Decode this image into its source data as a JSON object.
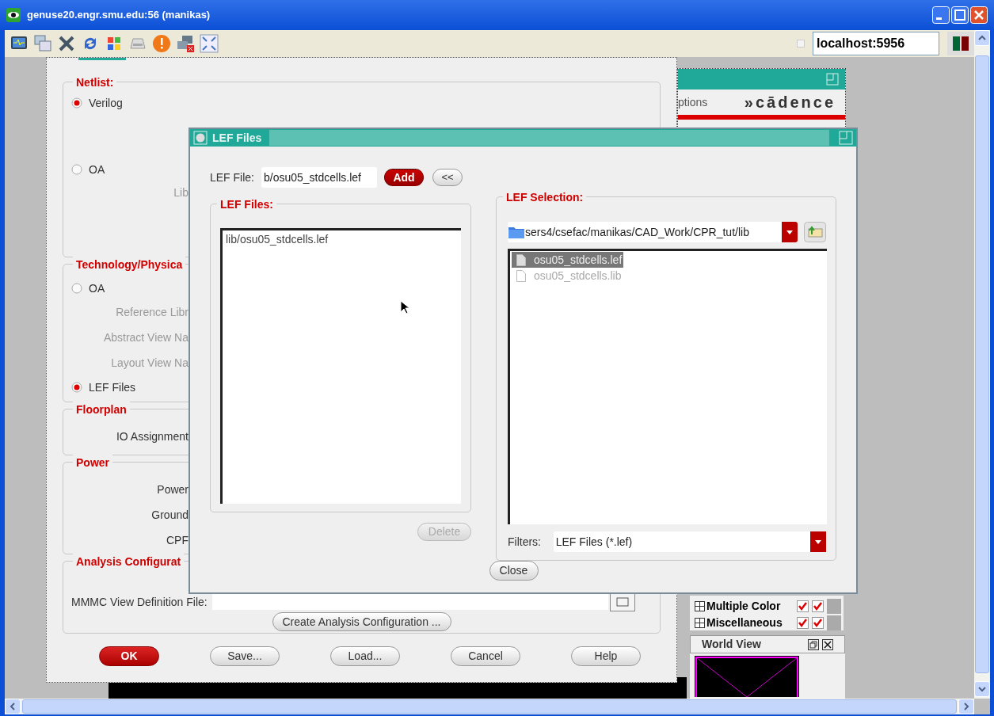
{
  "window": {
    "title": "genuse20.engr.smu.edu:56 (manikas)"
  },
  "toolbar": {
    "host": "localhost:5956"
  },
  "back_window": {
    "options_label": "ptions",
    "logo": "»cādence",
    "layers": [
      {
        "label": "Multiple Color",
        "visible": true,
        "selectable": true
      },
      {
        "label": "Miscellaneous",
        "visible": true,
        "selectable": true
      }
    ],
    "world_view_title": "World View"
  },
  "design_import": {
    "sections": [
      {
        "title": "Netlist:",
        "rows": [
          {
            "kind": "radio",
            "label": "Verilog",
            "selected": true
          },
          {
            "kind": "radio",
            "label": "OA",
            "selected": false
          },
          {
            "kind": "label",
            "label": "Lib",
            "disabled": true
          }
        ]
      },
      {
        "title": "Technology/Physica",
        "rows": [
          {
            "kind": "radio",
            "label": "OA",
            "selected": false
          },
          {
            "kind": "label",
            "label": "Reference Libr",
            "disabled": true
          },
          {
            "kind": "label",
            "label": "Abstract View Na",
            "disabled": true
          },
          {
            "kind": "label",
            "label": "Layout View Na",
            "disabled": true
          },
          {
            "kind": "radio",
            "label": "LEF Files",
            "selected": true
          }
        ]
      },
      {
        "title": "Floorplan",
        "rows": [
          {
            "kind": "label",
            "label": "IO Assignment",
            "disabled": false
          }
        ]
      },
      {
        "title": "Power",
        "rows": [
          {
            "kind": "label",
            "label": "Power",
            "disabled": false
          },
          {
            "kind": "label",
            "label": "Ground",
            "disabled": false
          },
          {
            "kind": "label",
            "label": "CPF",
            "disabled": false
          }
        ]
      },
      {
        "title": "Analysis Configurat",
        "rows": [
          {
            "kind": "file",
            "label": "MMMC View Definition File:"
          },
          {
            "kind": "button",
            "label": "Create Analysis Configuration ..."
          }
        ]
      }
    ],
    "buttons": [
      {
        "label": "OK",
        "default": true
      },
      {
        "label": "Save...",
        "default": false
      },
      {
        "label": "Load...",
        "default": false
      },
      {
        "label": "Cancel",
        "default": false
      },
      {
        "label": "Help",
        "default": false
      }
    ]
  },
  "lef_dialog": {
    "title": "LEF Files",
    "lef_file_label": "LEF File:",
    "lef_file_value": "b/osu05_stdcells.lef",
    "add_button": "Add",
    "back_button": "<<",
    "files_title": "LEF Files:",
    "files": [
      "lib/osu05_stdcells.lef"
    ],
    "delete_button": {
      "label": "Delete",
      "disabled": true
    },
    "selection_title": "LEF Selection:",
    "path": "sers4/csefac/manikas/CAD_Work/CPR_tut/lib",
    "selection": [
      {
        "name": "osu05_stdcells.lef",
        "selected": true,
        "disabled": false
      },
      {
        "name": "osu05_stdcells.lib",
        "selected": false,
        "disabled": true
      }
    ],
    "filters_label": "Filters:",
    "filter_value": "LEF Files (*.lef)",
    "close_button": "Close"
  }
}
